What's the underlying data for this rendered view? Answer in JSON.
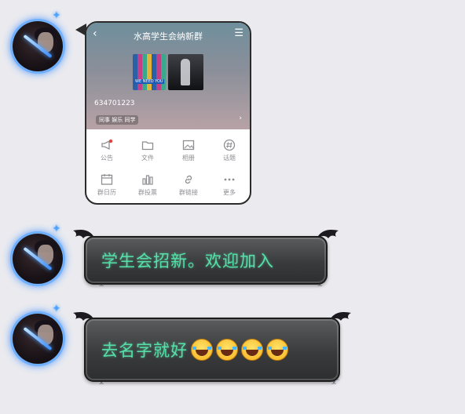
{
  "group_card": {
    "title": "水高学生会纳新群",
    "group_id": "634701223",
    "tagline": "同事 娱乐 同学",
    "thumbnail_caption": "WE NEED YOU",
    "actions": [
      {
        "label": "公告",
        "icon": "megaphone-icon"
      },
      {
        "label": "文件",
        "icon": "folder-icon"
      },
      {
        "label": "相册",
        "icon": "image-icon"
      },
      {
        "label": "话题",
        "icon": "hashtag-icon"
      },
      {
        "label": "群日历",
        "icon": "calendar-icon"
      },
      {
        "label": "群投票",
        "icon": "bar-chart-icon"
      },
      {
        "label": "群链接",
        "icon": "link-icon"
      },
      {
        "label": "更多",
        "icon": "more-dots-icon"
      }
    ]
  },
  "messages": [
    {
      "text": "学生会招新。欢迎加入"
    },
    {
      "text": "去名字就好",
      "emoji": "laughing-tears-emoji",
      "emoji_count": 4
    }
  ],
  "colors": {
    "background": "#ebebef",
    "bubble_text": "#55e0a9",
    "bubble_fill": "#3a3b3d",
    "avatar_glow": "#4fa3ff",
    "notify_dot": "#e0443a"
  }
}
